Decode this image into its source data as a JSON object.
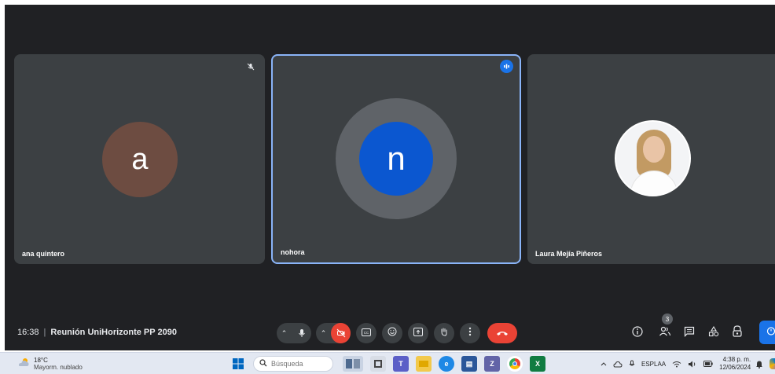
{
  "meeting": {
    "time": "16:38",
    "separator": "|",
    "title": "Reunión UniHorizonte PP 2090"
  },
  "participants": [
    {
      "name": "ana quintero",
      "initial": "a",
      "muted": true
    },
    {
      "name": "nohora",
      "initial": "n",
      "speaking": true
    },
    {
      "name": "Laura Mejía Piñeros",
      "avatar": "photo"
    }
  ],
  "controls": {
    "people_count": "3"
  },
  "colors": {
    "meet_bg": "#202124",
    "tile_bg": "#3c4043",
    "active_border": "#8ab4f8",
    "end_call": "#ea4335",
    "avatar_a": "#6d4c41",
    "avatar_n": "#0b57d0"
  },
  "taskbar": {
    "weather": {
      "temp": "18°C",
      "condition": "Mayorm. nublado"
    },
    "search_placeholder": "Búsqueda",
    "language": {
      "line1": "ESP",
      "line2": "LAA"
    },
    "clock": {
      "time": "4:38 p. m.",
      "date": "12/06/2024"
    }
  },
  "icons": [
    "mic-icon",
    "camera-off-icon",
    "captions-icon",
    "emoji-icon",
    "present-icon",
    "raise-hand-icon",
    "more-options-icon",
    "end-call-icon",
    "info-icon",
    "people-icon",
    "chat-icon",
    "activities-icon",
    "host-controls-icon"
  ]
}
